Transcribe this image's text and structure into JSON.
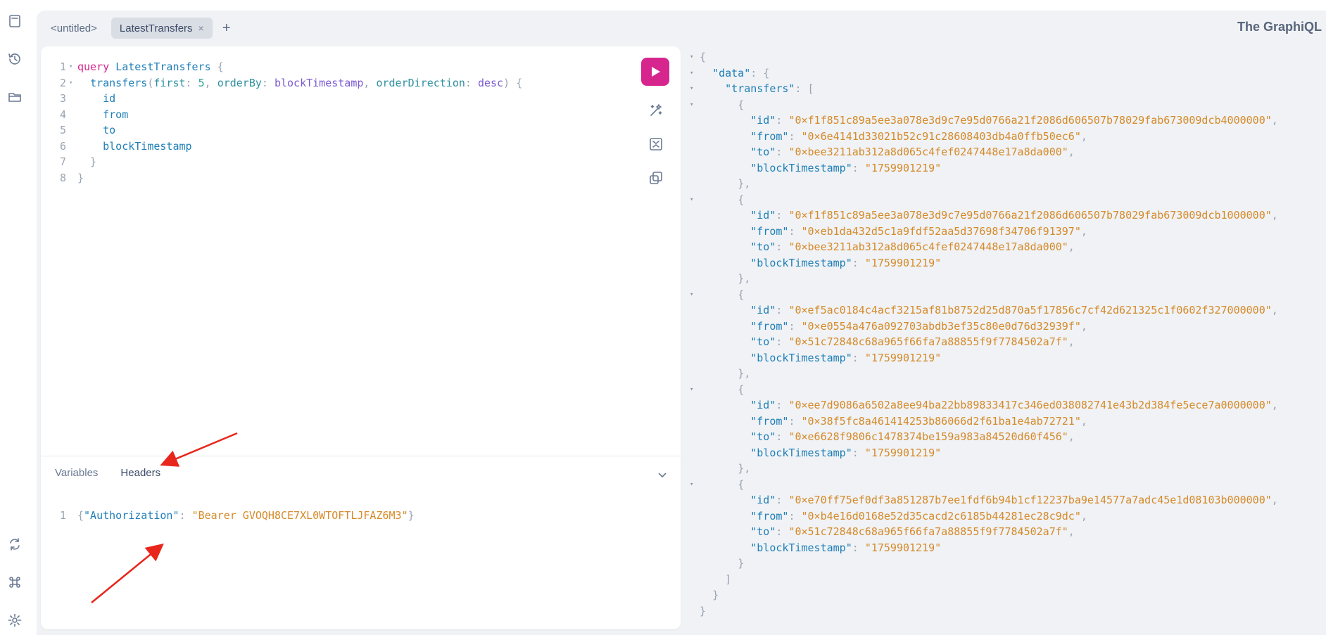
{
  "tabs": [
    {
      "label": "<untitled>",
      "active": false
    },
    {
      "label": "LatestTransfers",
      "active": true,
      "close": "×"
    }
  ],
  "tab_add": "+",
  "brand": "The GraphiQL",
  "query": {
    "keyword": "query",
    "name": "LatestTransfers",
    "field": "transfers",
    "args": [
      {
        "name": "first",
        "value": "5"
      },
      {
        "name": "orderBy",
        "value": "blockTimestamp"
      },
      {
        "name": "orderDirection",
        "value": "desc"
      }
    ],
    "selections": [
      "id",
      "from",
      "to",
      "blockTimestamp"
    ]
  },
  "editor_tabs": {
    "variables": "Variables",
    "headers": "Headers"
  },
  "headers_json": {
    "key": "\"Authorization\"",
    "value": "\"Bearer GVOQH8CE7XL0WTOFTLJFAZ6M3\""
  },
  "results": {
    "transfers": [
      {
        "id": "0×f1f851c89a5ee3a078e3d9c7e95d0766a21f2086d606507b78029fab673009dcb4000000",
        "from": "0×6e4141d33021b52c91c28608403db4a0ffb50ec6",
        "to": "0×bee3211ab312a8d065c4fef0247448e17a8da000",
        "blockTimestamp": "1759901219"
      },
      {
        "id": "0×f1f851c89a5ee3a078e3d9c7e95d0766a21f2086d606507b78029fab673009dcb1000000",
        "from": "0×eb1da432d5c1a9fdf52aa5d37698f34706f91397",
        "to": "0×bee3211ab312a8d065c4fef0247448e17a8da000",
        "blockTimestamp": "1759901219"
      },
      {
        "id": "0×ef5ac0184c4acf3215af81b8752d25d870a5f17856c7cf42d621325c1f0602f327000000",
        "from": "0×e0554a476a092703abdb3ef35c80e0d76d32939f",
        "to": "0×51c72848c68a965f66fa7a88855f9f7784502a7f",
        "blockTimestamp": "1759901219"
      },
      {
        "id": "0×ee7d9086a6502a8ee94ba22bb89833417c346ed038082741e43b2d384fe5ece7a0000000",
        "from": "0×38f5fc8a461414253b86066d2f61ba1e4ab72721",
        "to": "0×e6628f9806c1478374be159a983a84520d60f456",
        "blockTimestamp": "1759901219"
      },
      {
        "id": "0×e70ff75ef0df3a851287b7ee1fdf6b94b1cf12237ba9e14577a7adc45e1d08103b000000",
        "from": "0×b4e16d0168e52d35cacd2c6185b44281ec28c9dc",
        "to": "0×51c72848c68a965f66fa7a88855f9f7784502a7f",
        "blockTimestamp": "1759901219"
      }
    ]
  },
  "colors": {
    "accent": "#d6268e",
    "annotation": "#e8261c"
  }
}
